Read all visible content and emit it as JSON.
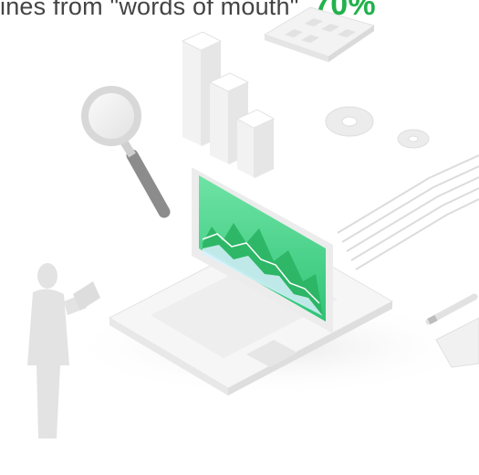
{
  "headline": {
    "text": "ines from \"words of mouth\"",
    "value": "70%"
  },
  "illustration": {
    "items": [
      "magnifying-glass-icon",
      "bar-chart-blocks",
      "calculator-icon",
      "gear-icon",
      "laptop",
      "circuit-lines",
      "pen-icon",
      "person-silhouette"
    ]
  },
  "colors": {
    "accent": "#22b14c",
    "text": "#444444",
    "screen": "#44d487"
  }
}
